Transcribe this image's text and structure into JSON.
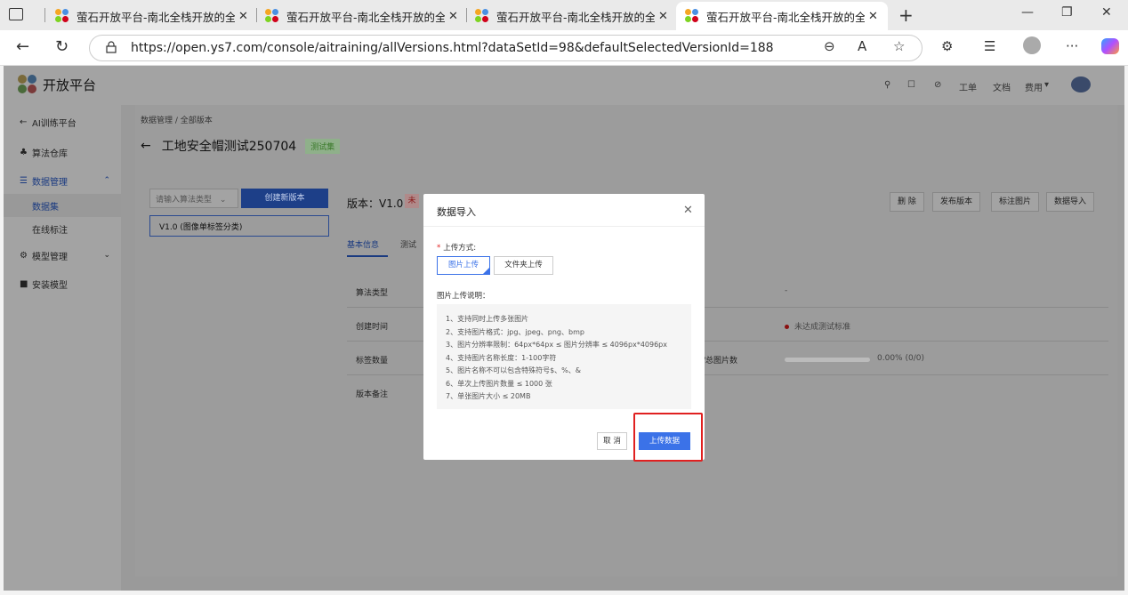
{
  "browser": {
    "tabs": [
      {
        "title": "萤石开放平台-南北全栈开放的全生态"
      },
      {
        "title": "萤石开放平台-南北全栈开放的全生态"
      },
      {
        "title": "萤石开放平台-南北全栈开放的全生态"
      },
      {
        "title": "萤石开放平台-南北全栈开放的全生态"
      }
    ],
    "url": "https://open.ys7.com/console/aitraining/allVersions.html?dataSetId=98&defaultSelectedVersionId=188"
  },
  "topnav": {
    "brand": "开放平台",
    "links": [
      "工单",
      "文档",
      "费用"
    ]
  },
  "sidebar": {
    "back": "AI训练平台",
    "items": [
      "算法仓库",
      "数据管理",
      "数据集",
      "在线标注",
      "模型管理",
      "安装模型"
    ]
  },
  "content": {
    "breadcrumb": "数据管理  /  全部版本",
    "title": "工地安全帽测试250704",
    "badge": "测试集",
    "alg_placeholder": "请输入算法类型",
    "create_btn": "创建新版本",
    "version_item": "V1.0  (图像单标签分类)",
    "version_label": "版本：V1.0",
    "version_tag": "未",
    "buttons": [
      "删 除",
      "发布版本",
      "标注图片",
      "数据导入"
    ],
    "tabs": [
      "基本信息",
      "测试"
    ],
    "rows": [
      {
        "k": "算法类型",
        "k2": "",
        "v2": "-"
      },
      {
        "k": "创建时间",
        "k2": "",
        "v2": "未达成测试标准"
      },
      {
        "k": "标签数量",
        "k2": "/总图片数",
        "v2": "0.00%  (0/0)"
      },
      {
        "k": "版本备注",
        "k2": "",
        "v2": ""
      }
    ]
  },
  "dialog": {
    "title": "数据导入",
    "upload_method_label": "上传方式:",
    "btn_image": "图片上传",
    "btn_folder": "文件夹上传",
    "desc_title": "图片上传说明：",
    "desc_items": [
      "1、支持同时上传多张图片",
      "2、支持图片格式：jpg、jpeg、png、bmp",
      "3、图片分辨率限制：64px*64px ≤ 图片分辨率 ≤ 4096px*4096px",
      "4、支持图片名称长度：1-100字符",
      "5、图片名称不可以包含特殊符号$、%、&",
      "6、单次上传图片数量 ≤ 1000 张",
      "7、单张图片大小 ≤ 20MB"
    ],
    "cancel": "取 消",
    "upload": "上传数据"
  }
}
